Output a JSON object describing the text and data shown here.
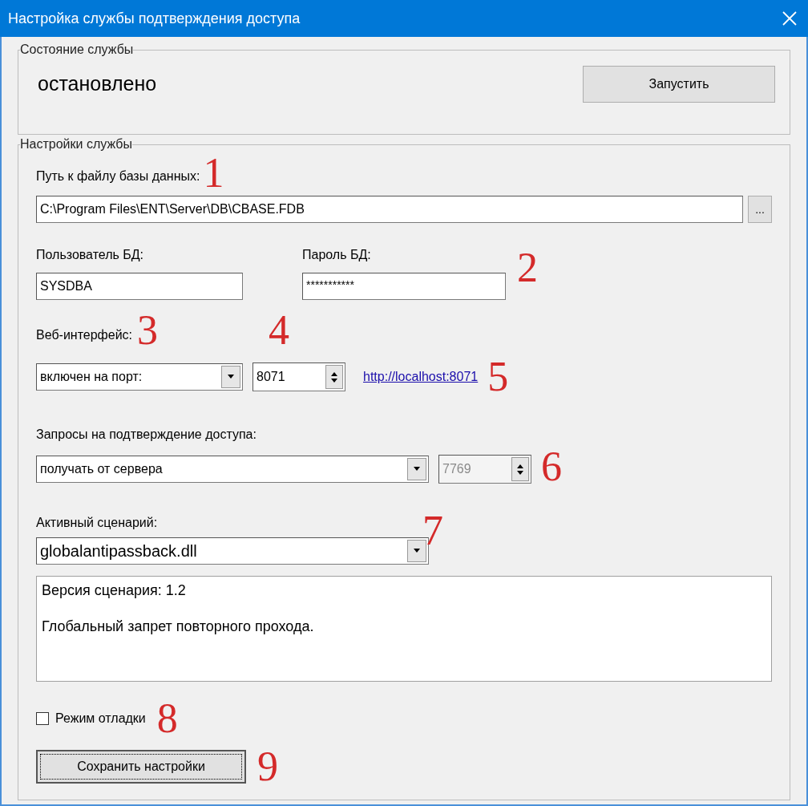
{
  "window": {
    "title": "Настройка службы подтверждения доступа"
  },
  "status_group": {
    "title": "Состояние службы",
    "status": "остановлено",
    "button": "Запустить"
  },
  "settings_group": {
    "title": "Настройки службы",
    "db_path": {
      "label": "Путь к файлу базы данных:",
      "marker": "1",
      "value": "C:\\Program Files\\ENT\\Server\\DB\\CBASE.FDB",
      "browse_button": "..."
    },
    "db_user": {
      "label": "Пользователь БД:",
      "value": "SYSDBA"
    },
    "db_password": {
      "label": "Пароль БД:",
      "value": "***********",
      "marker": "2"
    },
    "web_interface": {
      "label": "Веб-интерфейс:",
      "marker": "3",
      "mode": "включен на порт:",
      "port": {
        "value": "8071",
        "marker": "4",
        "disabled": false
      },
      "link": "http://localhost:8071",
      "link_marker": "5"
    },
    "requests": {
      "label": "Запросы на подтверждение доступа:",
      "mode": "получать от сервера",
      "port": {
        "value": "7769",
        "disabled": true
      },
      "marker": "6"
    },
    "script": {
      "label": "Активный сценарий:",
      "marker": "7",
      "value": "globalantipassback.dll",
      "description": [
        "Версия сценария: 1.2",
        "Глобальный запрет повторного прохода."
      ]
    },
    "debug_mode": {
      "label": "Режим отладки",
      "checked": false,
      "marker": "8"
    },
    "save_button": {
      "label": "Сохранить настройки",
      "marker": "9"
    }
  }
}
